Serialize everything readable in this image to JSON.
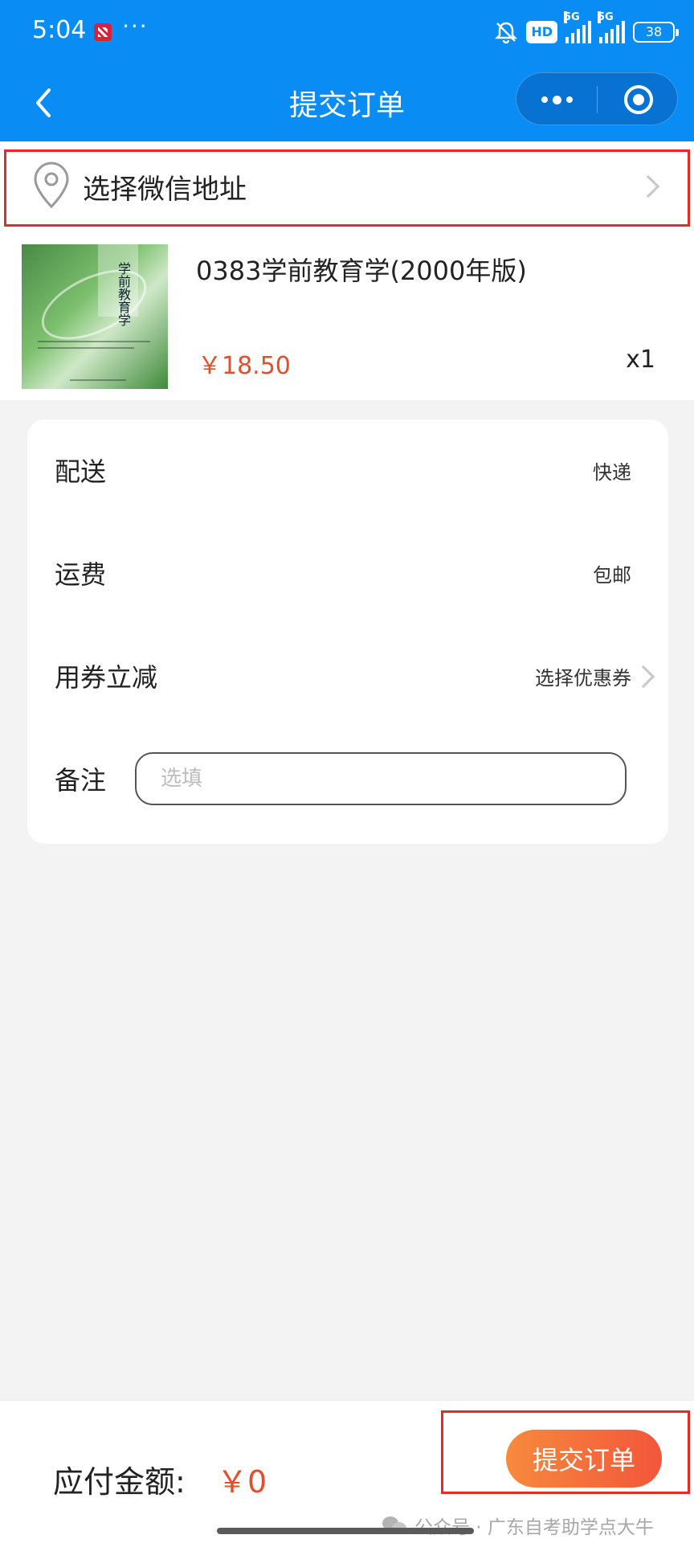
{
  "status_bar": {
    "time": "5:04",
    "more": "···",
    "hd": "HD",
    "network_1": "5G",
    "network_2": "5G",
    "battery": "38"
  },
  "nav": {
    "title": "提交订单"
  },
  "address": {
    "label": "选择微信地址"
  },
  "product": {
    "cover_title": "学前教育学",
    "title": "0383学前教育学(2000年版)",
    "price": "￥18.50",
    "quantity": "x1"
  },
  "details": {
    "delivery_label": "配送",
    "delivery_value": "快递",
    "shipping_label": "运费",
    "shipping_value": "包邮",
    "coupon_label": "用券立减",
    "coupon_value": "选择优惠券",
    "remark_label": "备注",
    "remark_placeholder": "选填"
  },
  "bottom": {
    "pay_label": "应付金额:",
    "pay_amount": "￥0",
    "submit_label": "提交订单",
    "watermark": "公众号 · 广东自考助学点大牛"
  },
  "colors": {
    "primary": "#0a8cf5",
    "price": "#e2502b",
    "highlight_box": "#e8282b",
    "submit_start": "#f78a3c",
    "submit_end": "#f2563b"
  }
}
